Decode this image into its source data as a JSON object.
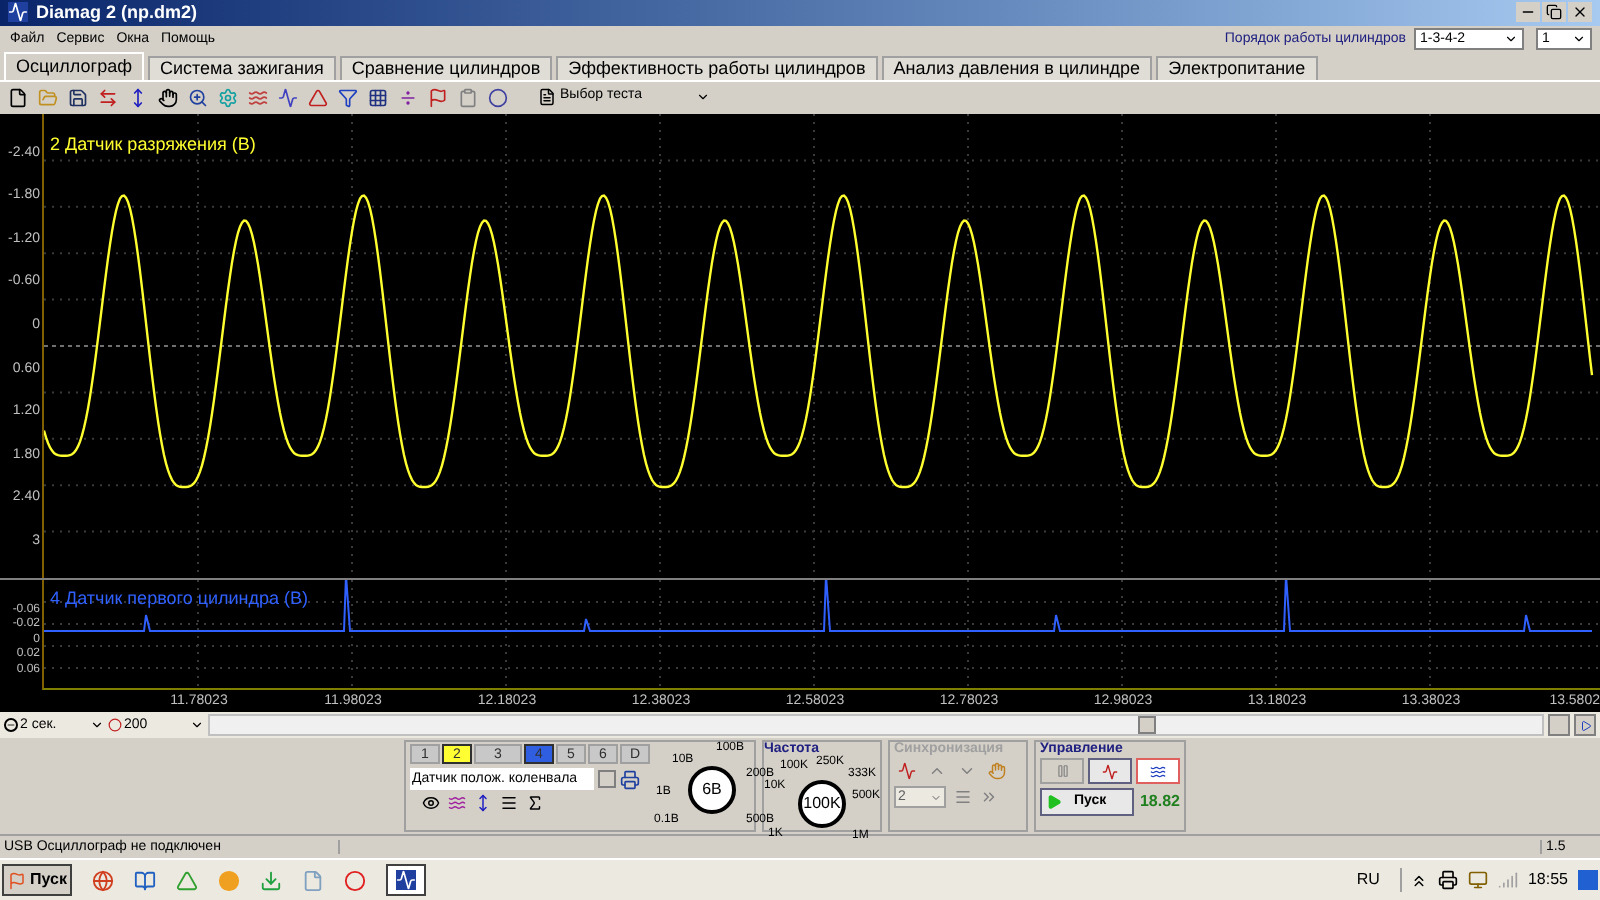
{
  "window": {
    "title": "Diamag 2 (np.dm2)"
  },
  "menu": [
    "Файл",
    "Сервис",
    "Окна",
    "Помощь"
  ],
  "cylinder_order": {
    "label": "Порядок работы цилиндров",
    "value": "1-3-4-2",
    "spin_value": "1"
  },
  "tabs": [
    {
      "label": "Осциллограф",
      "selected": true
    },
    {
      "label": "Система зажигания",
      "selected": false
    },
    {
      "label": "Сравнение цилиндров",
      "selected": false
    },
    {
      "label": "Эффективность работы цилиндров",
      "selected": false
    },
    {
      "label": "Анализ давления в цилиндре",
      "selected": false
    },
    {
      "label": "Электропитание",
      "selected": false
    }
  ],
  "toolbar": {
    "test_select": "Выбор теста"
  },
  "upper_chart": {
    "title": "2 Датчик разряжения (В)",
    "y_ticks": [
      "-2.40",
      "-1.80",
      "-1.20",
      "-0.60",
      "0",
      "0.60",
      "1.20",
      "1.80",
      "2.40",
      "3"
    ]
  },
  "lower_chart": {
    "title": "4 Датчик первого цилиндра (В)",
    "y_ticks": [
      "-0.06",
      "-0.02",
      "0",
      "0.02",
      "0.06"
    ]
  },
  "x_ticks": [
    "11.78023",
    "11.98023",
    "12.18023",
    "12.38023",
    "12.58023",
    "12.78023",
    "12.98023",
    "13.18023",
    "13.38023",
    "13.5802"
  ],
  "timebase": {
    "interval": "2 сек.",
    "points": "200"
  },
  "channels": {
    "buttons": [
      {
        "label": "1",
        "active": false,
        "color": "#c8c8c8"
      },
      {
        "label": "2",
        "active": true,
        "color": "#ffff33"
      },
      {
        "label": "3",
        "active": false,
        "color": "#c8c8c8"
      },
      {
        "label": "4",
        "active": true,
        "color": "#2f5fe0"
      },
      {
        "label": "5",
        "active": false,
        "color": "#c8c8c8"
      },
      {
        "label": "6",
        "active": false,
        "color": "#c8c8c8"
      },
      {
        "label": "D",
        "active": false,
        "color": "#c8c8c8"
      }
    ],
    "sensor": "Датчик полож. коленвала",
    "knob": {
      "labels": [
        "0.1В",
        "1В",
        "10В",
        "100В",
        "200В",
        "500В"
      ],
      "value": "6В"
    }
  },
  "frequency": {
    "title": "Частота",
    "labels": [
      "1K",
      "10K",
      "100K",
      "250K",
      "333K",
      "500K",
      "1M"
    ],
    "value": "100K"
  },
  "sync": {
    "title": "Синхронизация",
    "disabled": true,
    "select": "2"
  },
  "control": {
    "title": "Управление",
    "start": "Пуск",
    "reading": "18.82"
  },
  "status": {
    "message": "USB Осциллограф не подключен",
    "value": "1.5"
  },
  "taskbar": {
    "start": "Пуск",
    "lang": "RU",
    "time": "18:55"
  }
}
